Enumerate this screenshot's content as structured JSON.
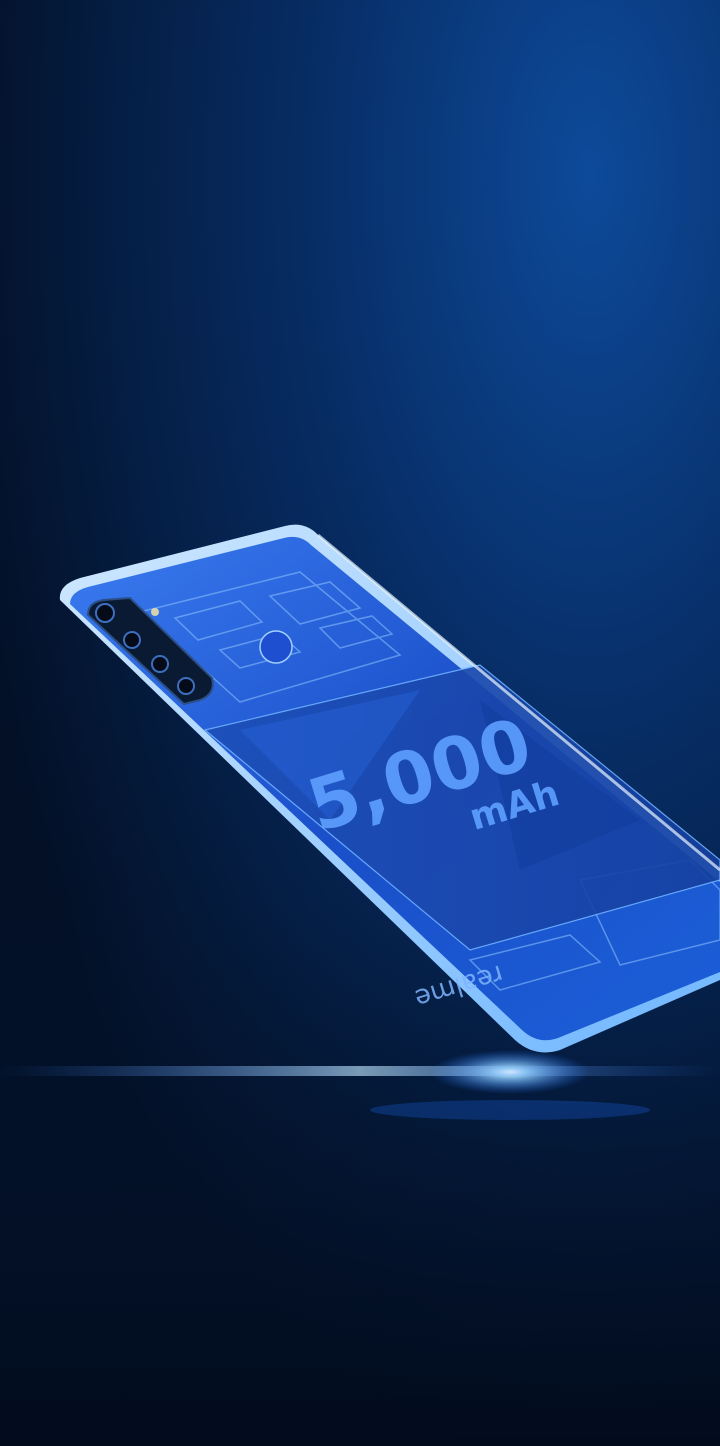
{
  "battery": {
    "capacity_number": "5,000",
    "capacity_unit": "mAh"
  },
  "brand": {
    "wordmark": "realme"
  },
  "colors": {
    "background_top": "#0b3a7a",
    "background_mid": "#062a5c",
    "background_bottom": "#031026",
    "phone_body": "#1e5fe0",
    "phone_edge": "#9fd0ff",
    "battery_text": "#5ea0ff",
    "light_flare": "#8fd6ff"
  }
}
